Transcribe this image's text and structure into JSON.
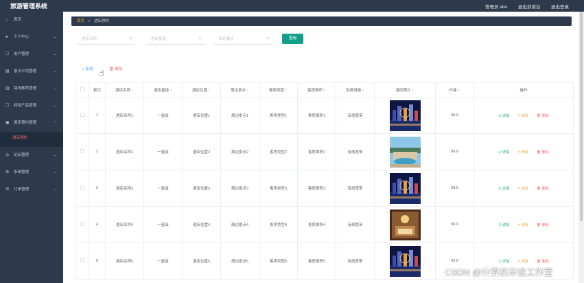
{
  "app": {
    "title": "旅游管理系统",
    "admin_label": "管理员 abo",
    "to_frontend": "退出到前台",
    "logout": "退出登录"
  },
  "sidebar": {
    "items": [
      {
        "label": "首页",
        "icon": "home-icon",
        "has_children": false
      },
      {
        "label": "个人中心",
        "icon": "user-icon",
        "has_children": true
      },
      {
        "label": "用户管理",
        "icon": "users-icon",
        "has_children": true
      },
      {
        "label": "景点介绍管理",
        "icon": "scenic-icon",
        "has_children": true
      },
      {
        "label": "路线推荐管理",
        "icon": "route-icon",
        "has_children": true
      },
      {
        "label": "特色产品管理",
        "icon": "product-icon",
        "has_children": true
      },
      {
        "label": "酒店预约管理",
        "icon": "hotel-icon",
        "has_children": true,
        "expanded": true
      },
      {
        "label": "论坛管理",
        "icon": "forum-icon",
        "has_children": true
      },
      {
        "label": "系统管理",
        "icon": "settings-icon",
        "has_children": true
      },
      {
        "label": "订单管理",
        "icon": "order-icon",
        "has_children": true
      }
    ],
    "active_sub": "酒店预约"
  },
  "breadcrumb": {
    "home": "首页",
    "separator": ">",
    "current": "酒店预约"
  },
  "search": {
    "hotel_name_placeholder": "酒店名称",
    "hotel_level_placeholder": "酒店星级",
    "nearby_placeholder": "周边景点",
    "query_button": "查询"
  },
  "actions": {
    "add": "+ 新增",
    "delete": "删除"
  },
  "table": {
    "columns": [
      "",
      "索引",
      "酒店名称",
      "酒店星级",
      "酒店位置",
      "周边景点",
      "客房类型",
      "客房面积",
      "免费设施",
      "酒店照片",
      "价格",
      "操作"
    ],
    "rows": [
      {
        "index": "1",
        "name": "酒店名称1",
        "level": "一星级",
        "location": "酒店位置1",
        "nearby": "周边景点1",
        "room_type": "客房类型1",
        "room_area": "客房面积1",
        "free": "有线宽带",
        "price": "99.9",
        "photo": "night-city-1"
      },
      {
        "index": "2",
        "name": "酒店名称2",
        "level": "一星级",
        "location": "酒店位置2",
        "nearby": "周边景点2",
        "room_type": "客房类型2",
        "room_area": "客房面积2",
        "free": "有线宽带",
        "price": "99.9",
        "photo": "resort-2"
      },
      {
        "index": "3",
        "name": "酒店名称3",
        "level": "一星级",
        "location": "酒店位置3",
        "nearby": "周边景点3",
        "room_type": "客房类型3",
        "room_area": "客房面积3",
        "free": "有线宽带",
        "price": "99.9",
        "photo": "night-city-3"
      },
      {
        "index": "4",
        "name": "酒店名称4",
        "level": "一星级",
        "location": "酒店位置4",
        "nearby": "周边景点4",
        "room_type": "客房类型4",
        "room_area": "客房面积4",
        "free": "有线宽带",
        "price": "99.9",
        "photo": "lobby-4"
      },
      {
        "index": "5",
        "name": "酒店名称5",
        "level": "一星级",
        "location": "酒店位置5",
        "nearby": "周边景点5",
        "room_type": "客房类型5",
        "room_area": "客房面积5",
        "free": "有线宽带",
        "price": "99.9",
        "photo": "night-city-5"
      }
    ],
    "row_actions": {
      "detail": "详情",
      "edit": "修改",
      "delete": "删除"
    }
  },
  "colors": {
    "sidebar_bg": "#2d3a4b",
    "accent_green": "#13a08a",
    "danger": "#f56c6c",
    "warning": "#e6a23c",
    "primary": "#409eff"
  },
  "watermark": "CSDN @计算机毕设工作室"
}
